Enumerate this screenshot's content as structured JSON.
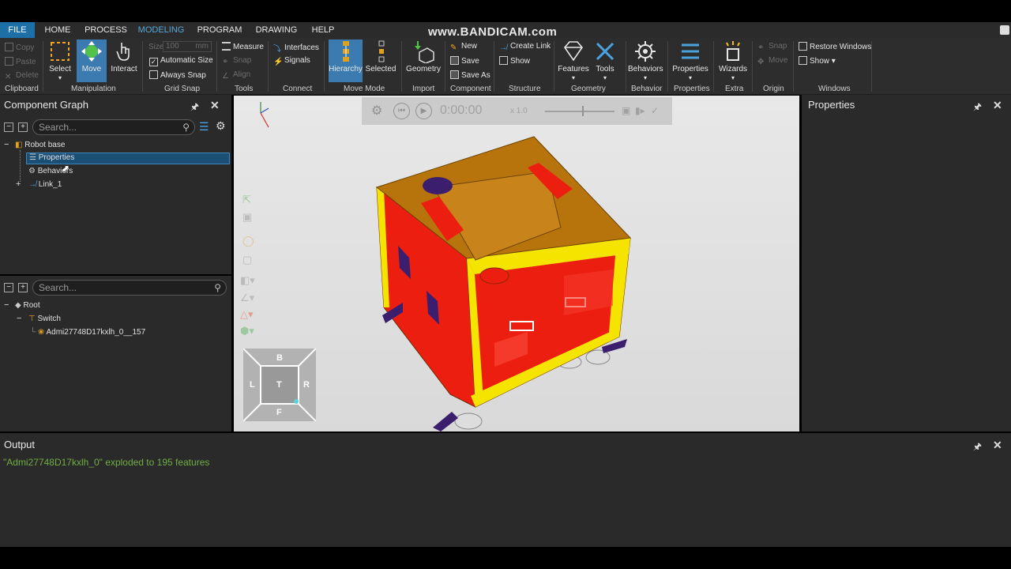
{
  "watermark": "www.BANDICAM.com",
  "menu": [
    "FILE",
    "HOME",
    "PROCESS",
    "MODELING",
    "PROGRAM",
    "DRAWING",
    "HELP"
  ],
  "ribbon": {
    "clipboard": {
      "copy": "Copy",
      "paste": "Paste",
      "delete": "Delete",
      "label": "Clipboard"
    },
    "manipulation": {
      "select": "Select",
      "move": "Move",
      "interact": "Interact",
      "label": "Manipulation"
    },
    "grid_snap": {
      "size_label": "Size",
      "size_value": "100",
      "size_unit": "mm",
      "automatic_size": "Automatic Size",
      "always_snap": "Always Snap",
      "label": "Grid Snap"
    },
    "tools": {
      "measure": "Measure",
      "snap": "Snap",
      "align": "Align",
      "label": "Tools"
    },
    "connect": {
      "interfaces": "Interfaces",
      "signals": "Signals",
      "label": "Connect"
    },
    "move_mode": {
      "hierarchy": "Hierarchy",
      "selected": "Selected",
      "label": "Move Mode"
    },
    "import": {
      "geometry": "Geometry",
      "label": "Import"
    },
    "component": {
      "new": "New",
      "save": "Save",
      "save_as": "Save As",
      "label": "Component"
    },
    "structure": {
      "create_link": "Create Link",
      "show": "Show",
      "label": "Structure"
    },
    "geometry": {
      "features": "Features",
      "tools": "Tools",
      "label": "Geometry"
    },
    "behavior": {
      "behaviors": "Behaviors",
      "label": "Behavior"
    },
    "properties": {
      "properties": "Properties",
      "label": "Properties"
    },
    "extra": {
      "wizards": "Wizards",
      "label": "Extra"
    },
    "origin": {
      "snap": "Snap",
      "move": "Move",
      "label": "Origin"
    },
    "windows": {
      "restore": "Restore Windows",
      "show": "Show ▾",
      "label": "Windows"
    }
  },
  "component_graph": {
    "title": "Component Graph",
    "search_placeholder": "Search...",
    "items": [
      "Robot base",
      "Properties",
      "Behaviors",
      "Link_1"
    ]
  },
  "hierarchy": {
    "search_placeholder": "Search...",
    "items": [
      "Root",
      "Switch",
      "Admi27748D17kxlh_0__157"
    ]
  },
  "viewport": {
    "time": "0:00:00",
    "speed": "x 1.0",
    "nav": {
      "top": "B",
      "left": "L",
      "center": "T",
      "right": "R",
      "bottom": "F"
    }
  },
  "properties_panel": {
    "title": "Properties"
  },
  "output": {
    "title": "Output",
    "line": "\"Admi27748D17kxlh_0\" exploded to 195 features"
  },
  "colors": {
    "accent": "#3b7bb0",
    "file_tab": "#1d6fa8",
    "output_text": "#6fae44",
    "box_top": "#b8740c",
    "box_side": "#ee1c0e",
    "frame": "#f5e400"
  }
}
